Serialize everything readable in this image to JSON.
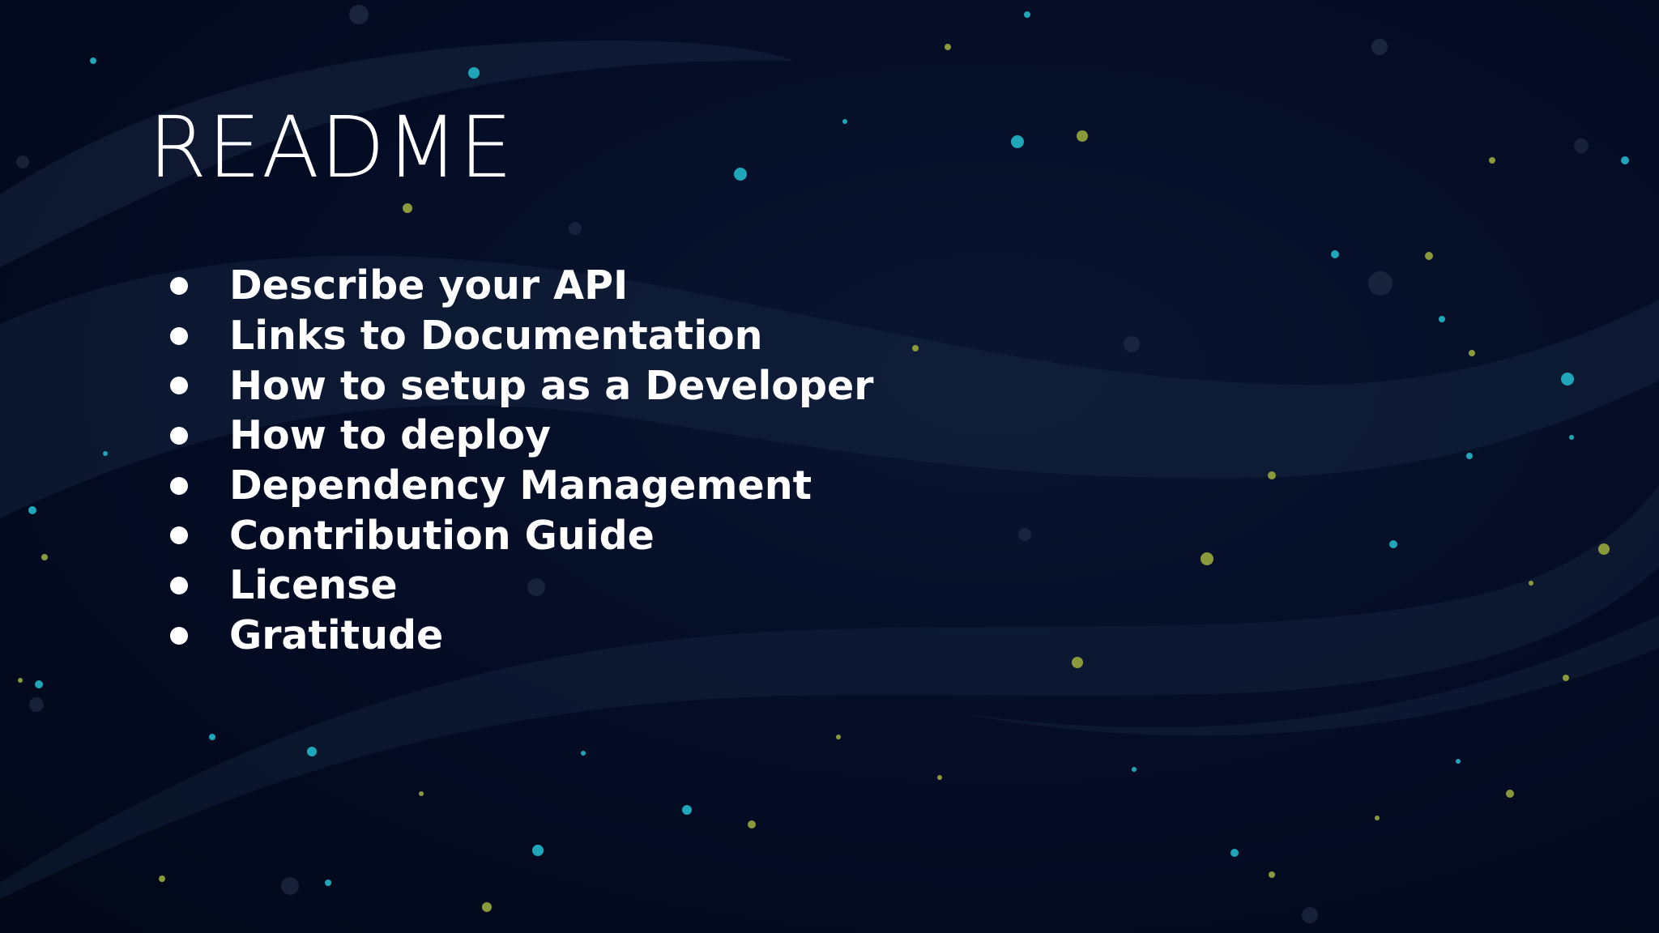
{
  "slide": {
    "title": "README",
    "bullets": [
      "Describe your API",
      "Links to Documentation",
      "How to setup as a Developer",
      "How to deploy",
      "Dependency Management",
      "Contribution Guide",
      "License",
      "Gratitude"
    ]
  },
  "colors": {
    "background": "#030b22",
    "text": "#ffffff",
    "wave": "#1a2a45",
    "star_teal": "#1fa6b8",
    "star_olive": "#8a9a3a",
    "star_gray": "#2a3550"
  }
}
